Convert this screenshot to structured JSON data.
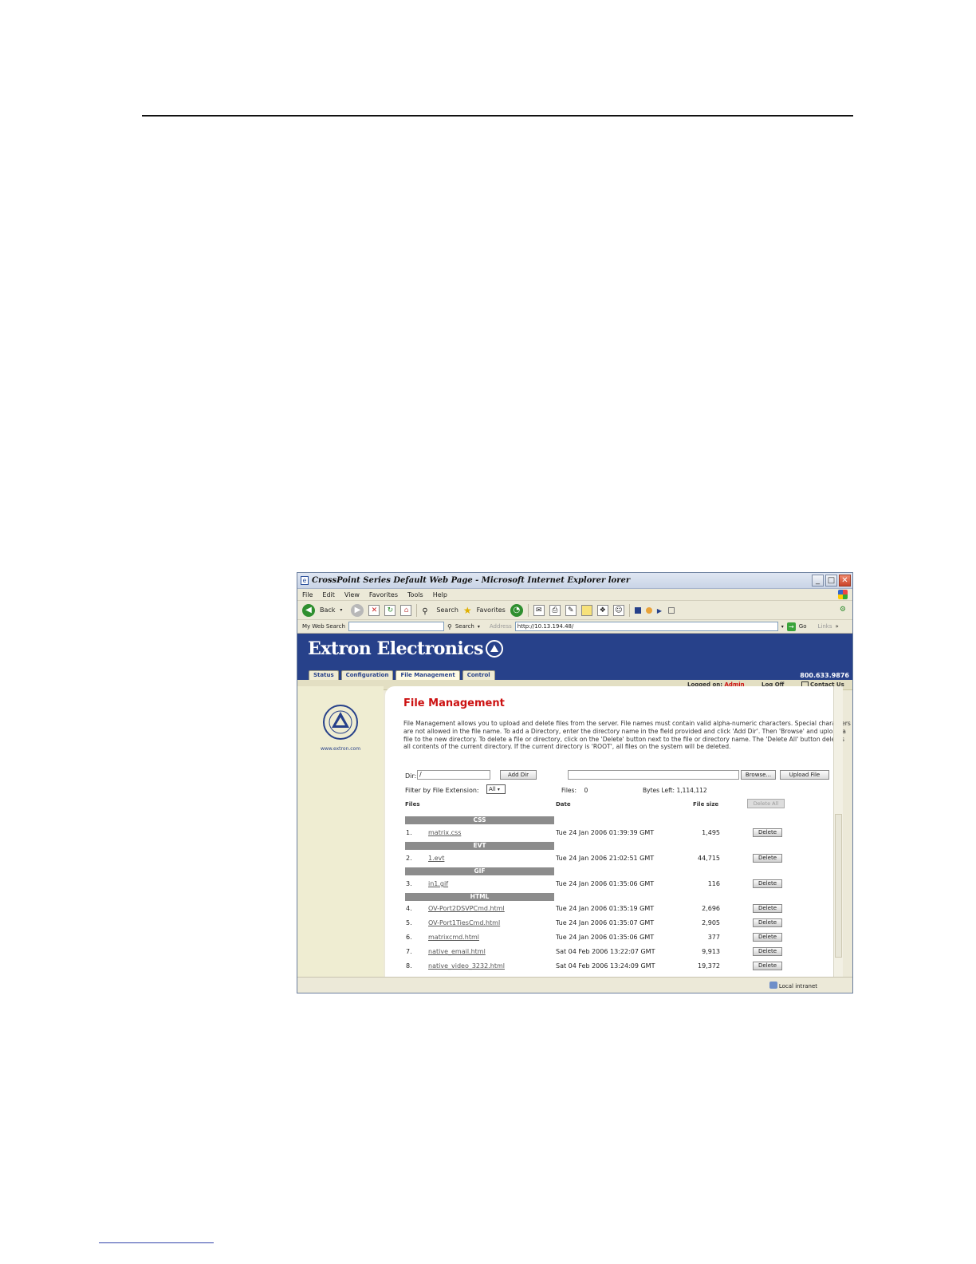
{
  "window": {
    "title": "CrossPoint Series Default Web Page - Microsoft Internet Explorer lorer",
    "minimize": "_",
    "maximize": "□",
    "close": "✕"
  },
  "menu": [
    "File",
    "Edit",
    "View",
    "Favorites",
    "Tools",
    "Help"
  ],
  "toolbar": {
    "back": "Back",
    "search": "Search",
    "favorites": "Favorites"
  },
  "addressbar": {
    "my_web_search": "My Web Search",
    "search_button": "Search",
    "address_label": "Address",
    "url": "http://10.13.194.48/",
    "go": "Go",
    "links": "Links"
  },
  "banner": {
    "brand": "Extron Electronics",
    "phone": "800.633.9876",
    "tabs": [
      "Status",
      "Configuration",
      "File Management",
      "Control"
    ]
  },
  "login": {
    "logged_on_label": "Logged on:",
    "user": "Admin",
    "log_off": "Log Off",
    "contact_us": "Contact Us"
  },
  "sidebar": {
    "url": "www.extron.com"
  },
  "page": {
    "title": "File Management",
    "description": "File Management allows you to upload and delete files from the server. File names must contain valid alpha-numeric characters. Special characters are not allowed in the file name. To add a Directory, enter the directory name in the field provided and click 'Add Dir'. Then 'Browse' and upload a file to the new directory. To delete a file or directory, click on the 'Delete' button next to the file or directory name. The 'Delete All' button deletes all contents of the current directory. If the current directory is 'ROOT', all files on the system will be deleted.",
    "dir_label": "Dir:",
    "dir_value": "/",
    "add_dir": "Add Dir",
    "browse": "Browse...",
    "upload_file": "Upload File",
    "filter_label": "Filter by File Extension:",
    "filter_value": "All",
    "files_label": "Files:",
    "files_count": "0",
    "bytes_left_label": "Bytes Left:",
    "bytes_left": "1,114,112",
    "col_files": "Files",
    "col_date": "Date",
    "col_size": "File size",
    "delete_all": "Delete All"
  },
  "groups": [
    "CSS",
    "EVT",
    "GIF",
    "HTML"
  ],
  "files": [
    {
      "num": "1.",
      "name": "matrix.css",
      "date": "Tue 24 Jan 2006 01:39:39 GMT",
      "size": "1,495",
      "action": "Delete"
    },
    {
      "num": "2.",
      "name": "1.evt",
      "date": "Tue 24 Jan 2006 21:02:51 GMT",
      "size": "44,715",
      "action": "Delete"
    },
    {
      "num": "3.",
      "name": "in1.gif",
      "date": "Tue 24 Jan 2006 01:35:06 GMT",
      "size": "116",
      "action": "Delete"
    },
    {
      "num": "4.",
      "name": "OV-Port2DSVPCmd.html",
      "date": "Tue 24 Jan 2006 01:35:19 GMT",
      "size": "2,696",
      "action": "Delete"
    },
    {
      "num": "5.",
      "name": "OV-Port1TiesCmd.html",
      "date": "Tue 24 Jan 2006 01:35:07 GMT",
      "size": "2,905",
      "action": "Delete"
    },
    {
      "num": "6.",
      "name": "matrixcmd.html",
      "date": "Tue 24 Jan 2006 01:35:06 GMT",
      "size": "377",
      "action": "Delete"
    },
    {
      "num": "7.",
      "name": "native_email.html",
      "date": "Sat 04 Feb 2006 13:22:07 GMT",
      "size": "9,913",
      "action": "Delete"
    },
    {
      "num": "8.",
      "name": "native_video_3232.html",
      "date": "Sat 04 Feb 2006 13:24:09 GMT",
      "size": "19,372",
      "action": "Delete"
    }
  ],
  "status": {
    "zone": "Local intranet"
  },
  "colors": {
    "banner": "#27418a",
    "title_red": "#cc1111",
    "sidebar": "#efedd2",
    "group_header": "#8c8c8c"
  }
}
